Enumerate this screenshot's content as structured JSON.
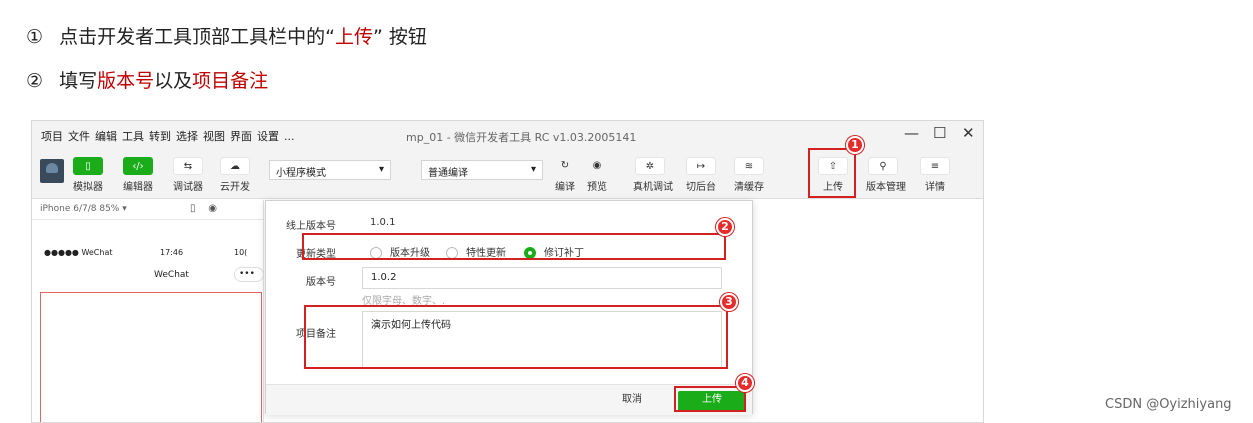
{
  "steps": {
    "step1": {
      "marker": "①",
      "pre": "点击开发者工具顶部工具栏中的“",
      "highlight": "上传",
      "post": "” 按钮"
    },
    "step2": {
      "marker": "②",
      "pre": "填写",
      "highlight1": "版本号",
      "mid": "以及",
      "highlight2": "项目备注"
    }
  },
  "window": {
    "menu": [
      "项目",
      "文件",
      "编辑",
      "工具",
      "转到",
      "选择",
      "视图",
      "界面",
      "设置",
      "..."
    ],
    "title": "mp_01 - 微信开发者工具 RC v1.03.2005141",
    "controls": {
      "minimize": "—",
      "maximize": "☐",
      "close": "✕"
    }
  },
  "toolbar": {
    "simulator": {
      "icon": "▯",
      "label": "模拟器"
    },
    "editor": {
      "icon": "‹/›",
      "label": "编辑器"
    },
    "debugger": {
      "icon": "⇆",
      "label": "调试器"
    },
    "cloud": {
      "icon": "☁",
      "label": "云开发"
    },
    "mode_select": "小程序模式",
    "compile_select": "普通编译",
    "compile": {
      "icon": "↻",
      "label": "编译"
    },
    "preview": {
      "icon": "◉",
      "label": "预览"
    },
    "realdebug": {
      "icon": "✲",
      "label": "真机调试"
    },
    "background": {
      "icon": "↦",
      "label": "切后台"
    },
    "cache": {
      "icon": "≋",
      "label": "清缓存"
    },
    "upload": {
      "icon": "⇧",
      "label": "上传"
    },
    "version": {
      "icon": "⚲",
      "label": "版本管理"
    },
    "details": {
      "icon": "≡",
      "label": "详情"
    }
  },
  "simulator": {
    "device": "iPhone 6/7/8 85% ▾",
    "status_left": "●●●●● WeChat",
    "status_time": "17:46",
    "status_battery": "10(",
    "nav_title": "WeChat",
    "capsule": "•••"
  },
  "dialog": {
    "online_version_label": "线上版本号",
    "online_version_value": "1.0.1",
    "update_type_label": "更新类型",
    "radio_major": "版本升级",
    "radio_feature": "特性更新",
    "radio_patch": "修订补丁",
    "version_label": "版本号",
    "version_value": "1.0.2",
    "version_hint": "仅限字母、数字、.",
    "notes_label": "项目备注",
    "notes_value": "演示如何上传代码",
    "cancel": "取消",
    "submit": "上传"
  },
  "badges": [
    "1",
    "2",
    "3",
    "4"
  ],
  "watermark": "CSDN @Oyizhiyang",
  "colors": {
    "accent_green": "#1aad19",
    "annotation_red": "#d32020",
    "text_red": "#c00000"
  }
}
